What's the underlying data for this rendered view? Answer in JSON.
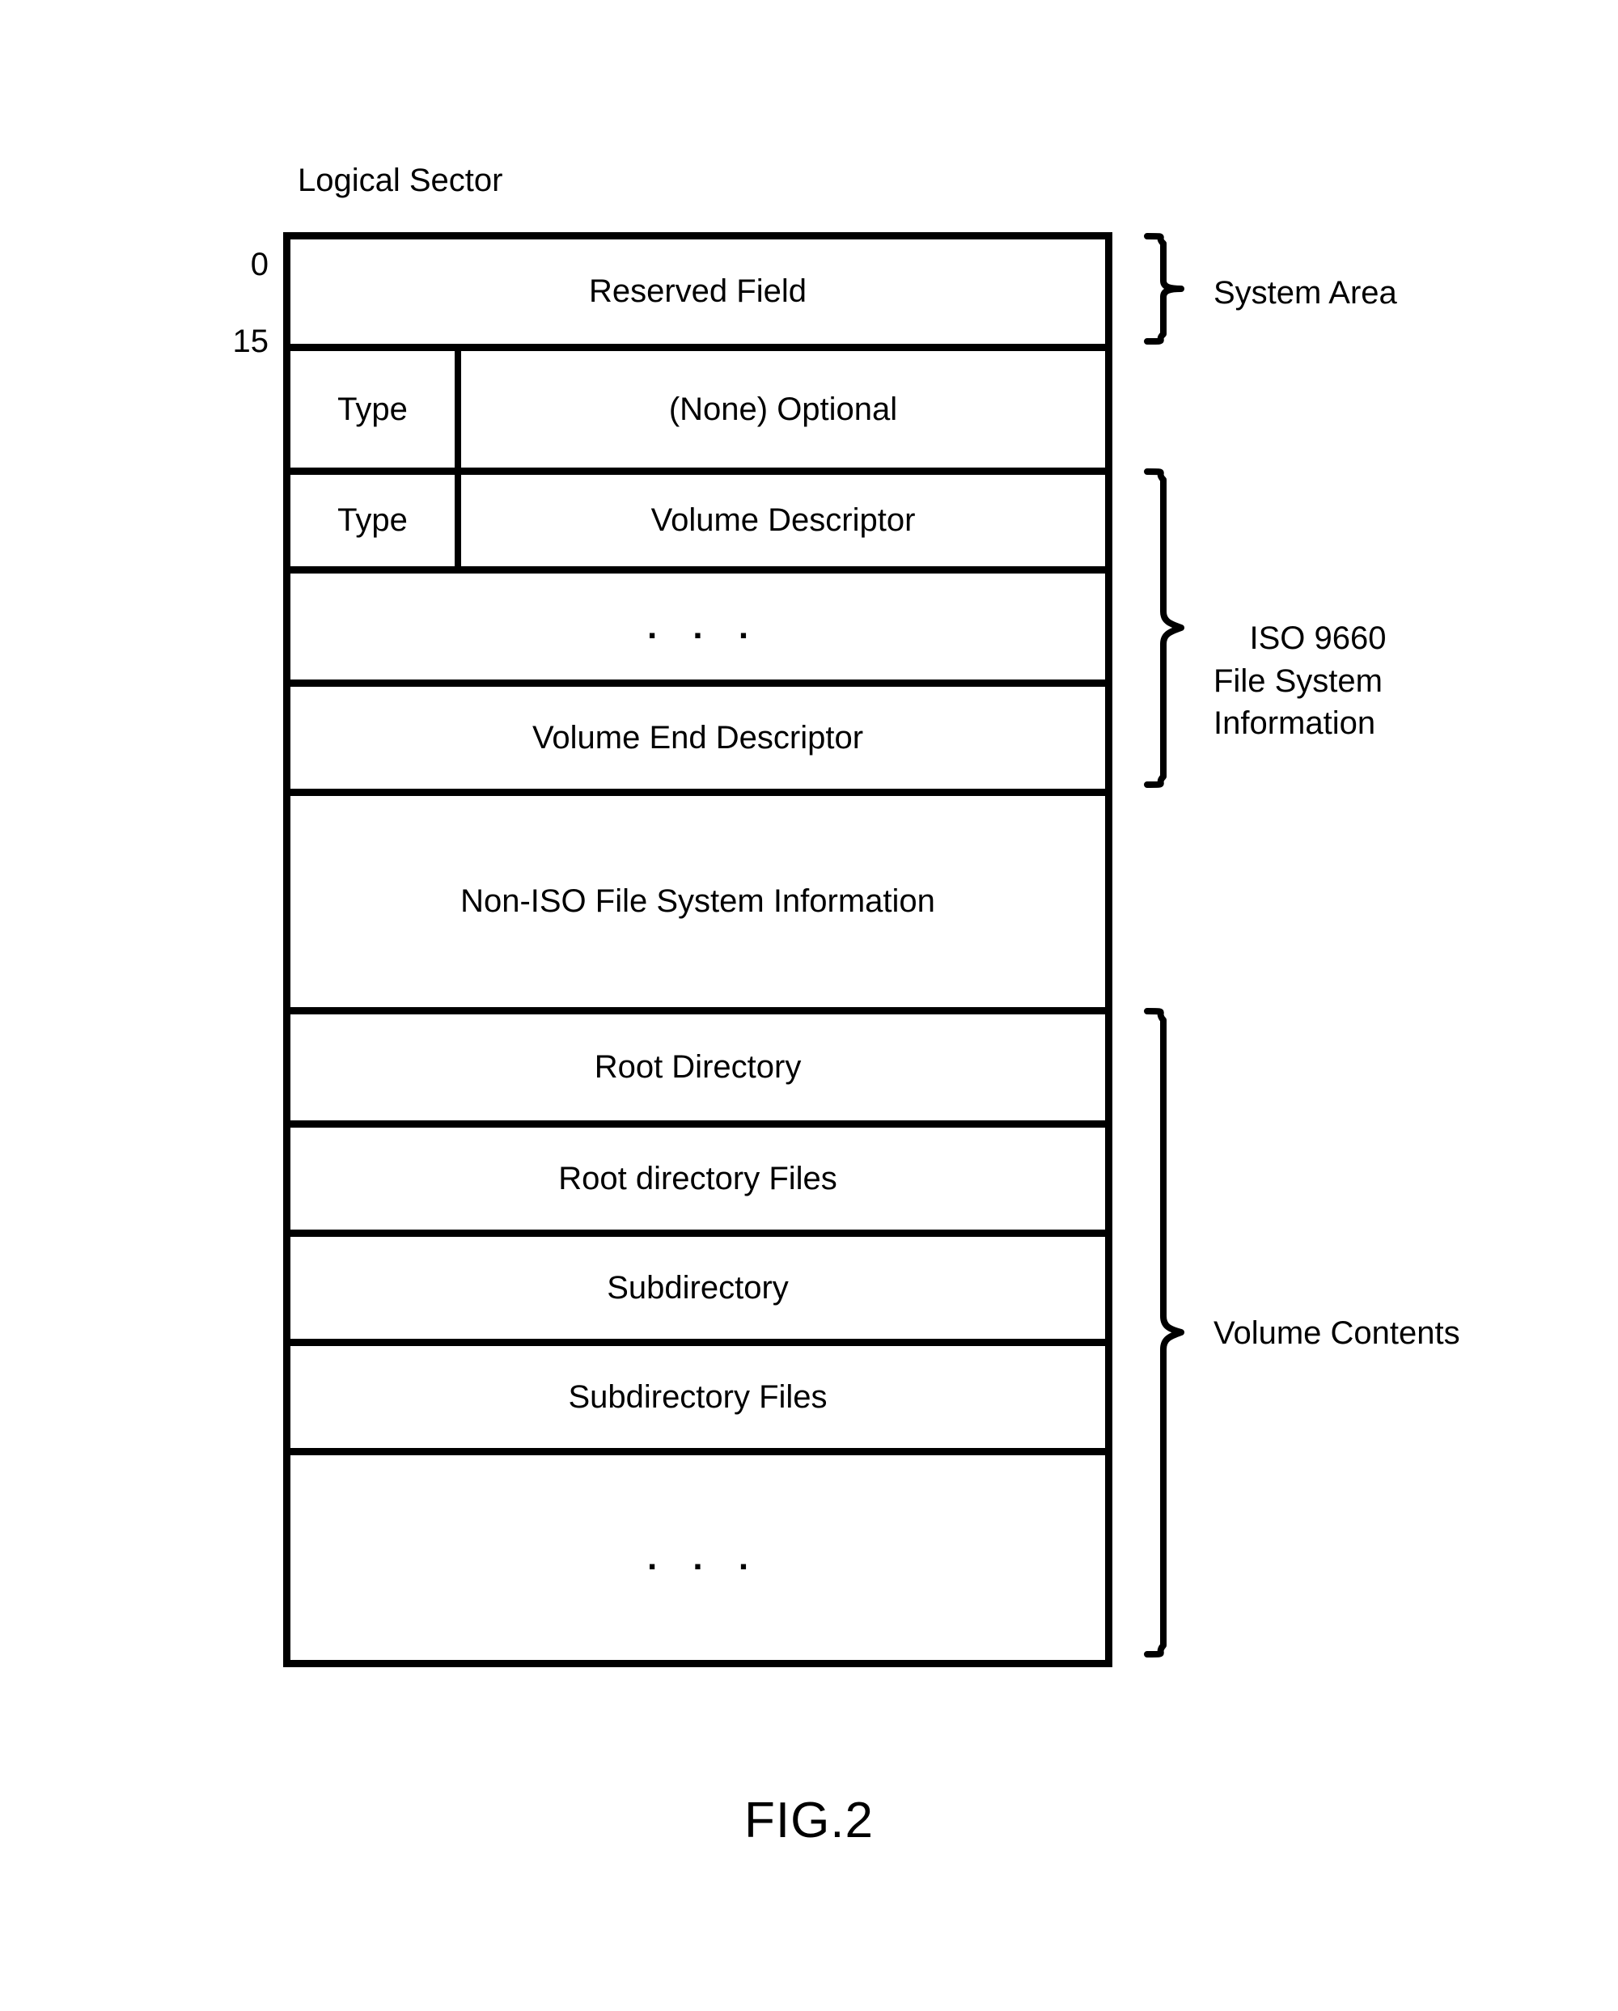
{
  "figure": {
    "caption": "FIG.2",
    "top_label": "Logical Sector"
  },
  "offsets": {
    "start": "0",
    "end": "15"
  },
  "type_column_label": "Type",
  "rows": [
    {
      "id": "reserved-field",
      "label": "Reserved Field",
      "split": false
    },
    {
      "id": "none-optional",
      "label": "(None) Optional",
      "split": true,
      "type_label": "Type"
    },
    {
      "id": "volume-descriptor",
      "label": "Volume Descriptor",
      "split": true,
      "type_label": "Type"
    },
    {
      "id": "descriptor-ellipsis",
      "label": ". . .",
      "split": false
    },
    {
      "id": "volume-end-descriptor",
      "label": "Volume End Descriptor",
      "split": false
    },
    {
      "id": "non-iso-info",
      "label": "Non-ISO File System Information",
      "split": false
    },
    {
      "id": "root-directory",
      "label": "Root Directory",
      "split": false
    },
    {
      "id": "root-directory-files",
      "label": "Root directory Files",
      "split": false
    },
    {
      "id": "subdirectory",
      "label": "Subdirectory",
      "split": false
    },
    {
      "id": "subdirectory-files",
      "label": "Subdirectory Files",
      "split": false
    },
    {
      "id": "contents-ellipsis",
      "label": ". . .",
      "split": false
    }
  ],
  "braces": {
    "system_area": {
      "label": "System Area"
    },
    "iso_file_system": {
      "label": "ISO 9660\nFile System\nInformation"
    },
    "volume_contents": {
      "label": "Volume Contents"
    }
  },
  "colors": {
    "ink": "#000000",
    "paper": "#ffffff"
  }
}
